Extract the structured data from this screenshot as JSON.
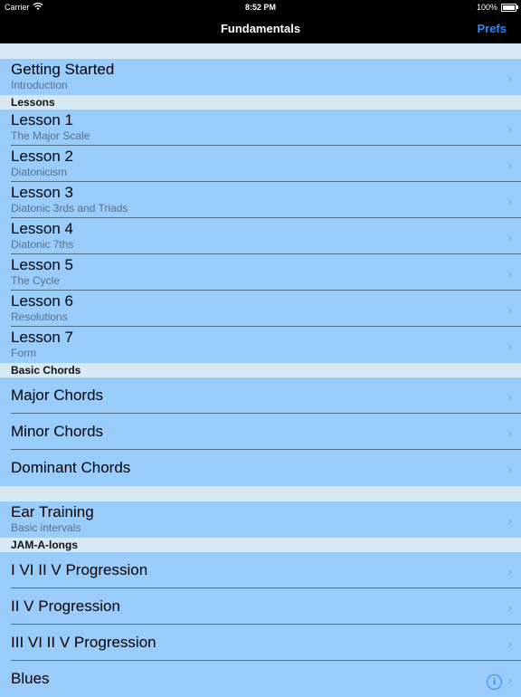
{
  "status": {
    "carrier": "Carrier",
    "time": "8:52 PM",
    "battery": "100%"
  },
  "nav": {
    "title": "Fundamentals",
    "prefs_label": "Prefs"
  },
  "rows": {
    "getting_started": {
      "title": "Getting Started",
      "subtitle": "Introduction"
    },
    "lessons_header": "Lessons",
    "lesson1": {
      "title": "Lesson 1",
      "subtitle": "The Major Scale"
    },
    "lesson2": {
      "title": "Lesson 2",
      "subtitle": "Diatonicism"
    },
    "lesson3": {
      "title": "Lesson 3",
      "subtitle": "Diatonic 3rds and Triads"
    },
    "lesson4": {
      "title": "Lesson 4",
      "subtitle": "Diatonic 7ths"
    },
    "lesson5": {
      "title": "Lesson 5",
      "subtitle": "The Cycle"
    },
    "lesson6": {
      "title": "Lesson 6",
      "subtitle": "Resolutions"
    },
    "lesson7": {
      "title": "Lesson 7",
      "subtitle": "Form"
    },
    "basic_chords_header": "Basic Chords",
    "major": {
      "title": "Major Chords"
    },
    "minor": {
      "title": "Minor Chords"
    },
    "dominant": {
      "title": "Dominant Chords"
    },
    "ear": {
      "title": "Ear Training",
      "subtitle": "Basic intervals"
    },
    "jam_header": "JAM-A-longs",
    "jam1": {
      "title": "I VI II V Progression"
    },
    "jam2": {
      "title": "II V Progression"
    },
    "jam3": {
      "title": "III VI II V Progression"
    },
    "blues": {
      "title": "Blues"
    }
  },
  "icons": {
    "chevron": "chevron-right-icon",
    "info": "info-icon"
  }
}
